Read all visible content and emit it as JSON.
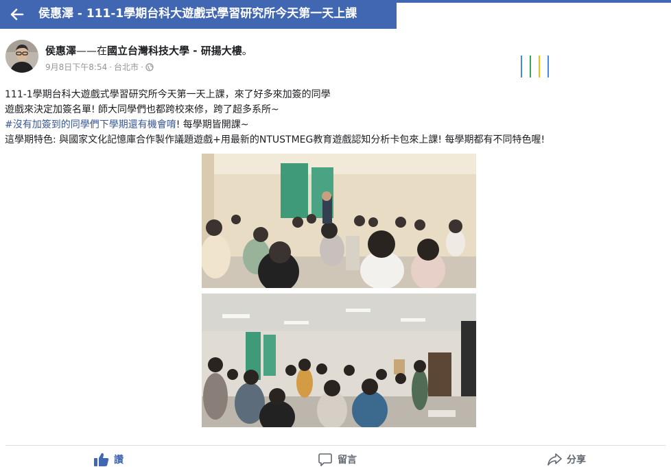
{
  "topbar": {
    "title": "侯惠澤 - 111-1學期台科大遊戲式學習研究所今天第一天上課"
  },
  "post": {
    "author": "侯惠澤",
    "separator": "——在",
    "location": "國立台灣科技大學 - 研揚大樓",
    "suffix": "。",
    "timestamp": "9月8日下午8:54",
    "dot": "·",
    "place": "台北市",
    "privacy_icon": "globe-icon",
    "text": {
      "line1": "111-1學期台科大遊戲式學習研究所今天第一天上課，來了好多來加簽的同學",
      "line2": "遊戲來決定加簽名單! 師大同學們也都跨校來修，跨了超多系所~",
      "hashtag": "#沒有加簽到的同學們下學期還有機會唷",
      "line3_rest": "! 每學期皆開課~",
      "line4": "這學期特色: 與國家文化記憶庫合作製作議題遊戲+用最新的NTUSTMEG教育遊戲認知分析卡包來上課! 每學期都有不同特色喔!"
    }
  },
  "loading": {
    "colors": [
      "#4285f4",
      "#34a853",
      "#fbbc05",
      "#4285f4"
    ]
  },
  "actions": {
    "like": "讚",
    "comment": "留言",
    "share": "分享"
  },
  "colors": {
    "brand": "#4267b2",
    "link": "#385898",
    "meta": "#90949c"
  }
}
